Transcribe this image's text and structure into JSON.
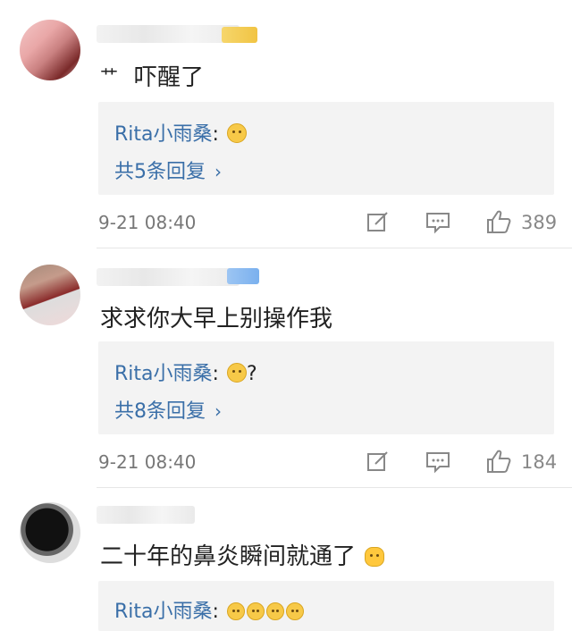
{
  "comments": [
    {
      "prefix_glyph": "艹",
      "text": "吓醒了",
      "reply": {
        "author": "Rita小雨桑",
        "author_suffix": ":",
        "extra": "",
        "more": "共5条回复"
      },
      "time": "9-21 08:40",
      "likes": "389"
    },
    {
      "prefix_glyph": "",
      "text": "求求你大早上别操作我",
      "reply": {
        "author": "Rita小雨桑",
        "author_suffix": ":",
        "extra": "?",
        "more": "共8条回复"
      },
      "time": "9-21 08:40",
      "likes": "184"
    },
    {
      "prefix_glyph": "",
      "text": "二十年的鼻炎瞬间就通了",
      "reply": {
        "author": "Rita小雨桑",
        "author_suffix": ":",
        "extra": "",
        "more": ""
      }
    }
  ],
  "icons": {
    "edit": "share-edit-icon",
    "comment": "comment-icon",
    "like": "thumbs-up-icon",
    "chevron": "chevron-right-icon"
  },
  "colors": {
    "link": "#3a6fa8",
    "reply_bg": "#f3f3f3",
    "meta": "#777777"
  }
}
